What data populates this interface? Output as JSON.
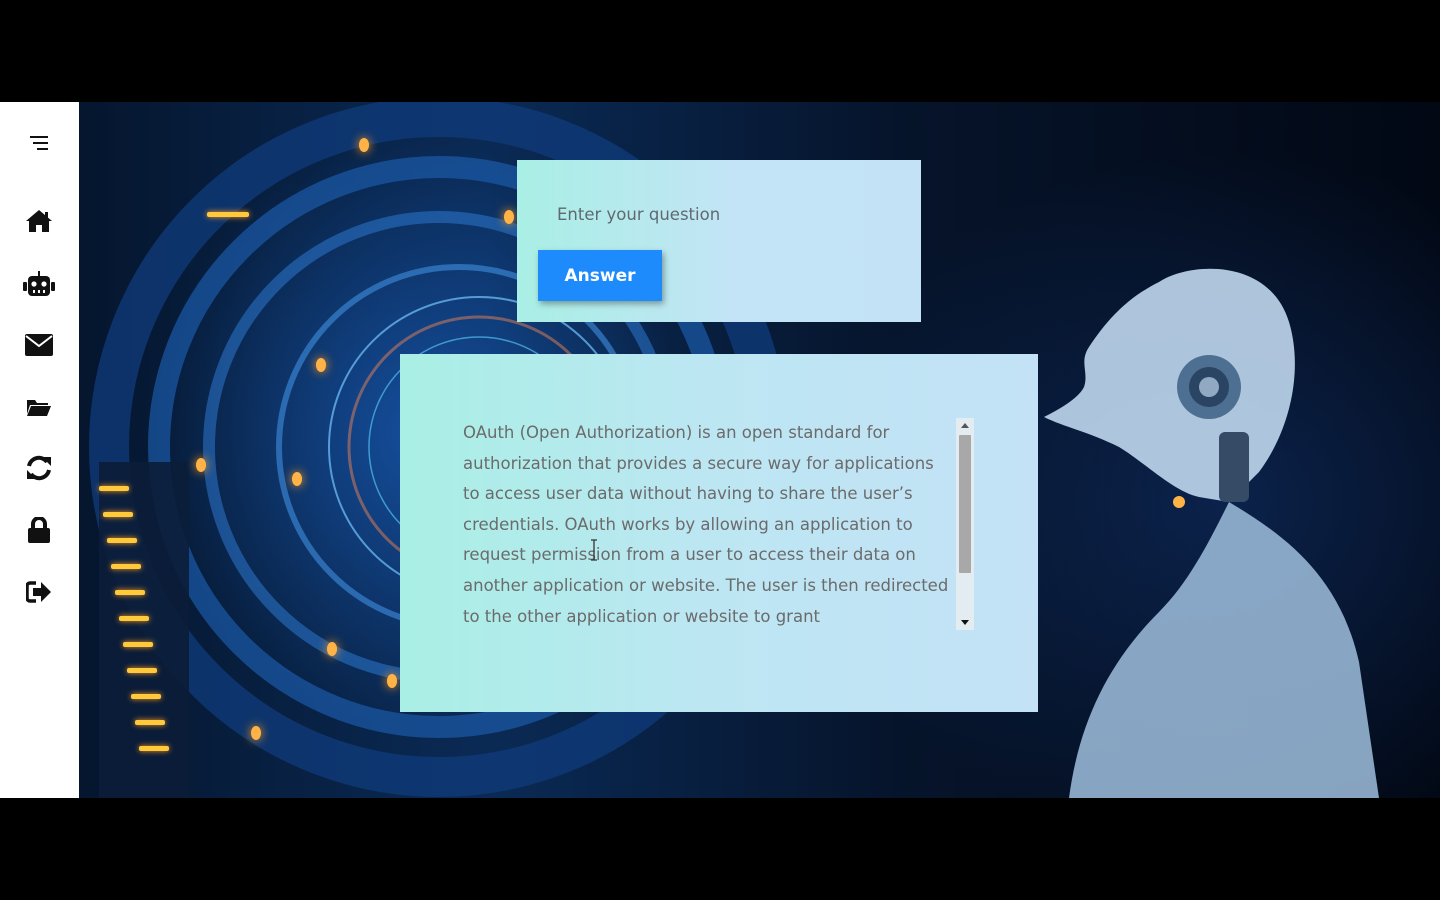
{
  "sidebar": {
    "items": [
      {
        "name": "menu",
        "icon": "menu-icon"
      },
      {
        "name": "home",
        "icon": "home-icon"
      },
      {
        "name": "robot",
        "icon": "robot-icon"
      },
      {
        "name": "mail",
        "icon": "mail-icon"
      },
      {
        "name": "folder",
        "icon": "folder-open-icon"
      },
      {
        "name": "refresh",
        "icon": "refresh-icon"
      },
      {
        "name": "lock",
        "icon": "lock-icon"
      },
      {
        "name": "logout",
        "icon": "sign-out-icon"
      }
    ]
  },
  "question": {
    "placeholder": "Enter your question",
    "value": "",
    "answer_button": "Answer"
  },
  "answer": {
    "text": "OAuth (Open Authorization) is an open standard for authorization that provides a secure way for applications to access user data without having to share the user’s credentials. OAuth works by allowing an application to request permission from a user to access their data on another application or website. The user is then redirected to the other application or website to grant"
  },
  "colors": {
    "accent": "#1d8bfb",
    "card_gradient_start": "#a9efe5",
    "card_gradient_end": "#c3e2f6",
    "sidebar": "#ffffff",
    "text": "#6b6b6b"
  }
}
